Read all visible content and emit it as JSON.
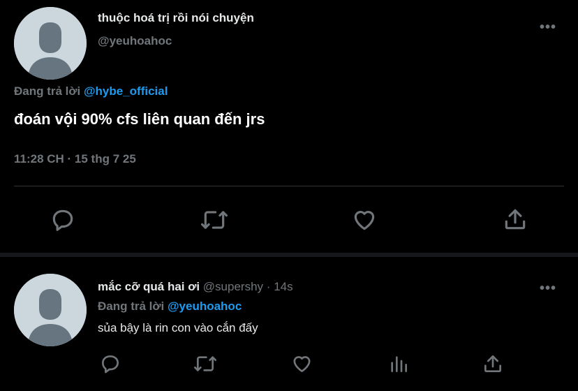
{
  "main_tweet": {
    "display_name": "thuộc hoá trị rồi nói chuyện",
    "handle": "@yeuhoahoc",
    "more_label": "•••",
    "replying_to_prefix": "Đang trả lời",
    "replying_to_handle": "@hybe_official",
    "text": "đoán vội 90% cfs liên quan đến jrs",
    "timestamp": "11:28 CH · 15 thg 7 25",
    "actions": [
      "reply-icon",
      "retweet-icon",
      "like-icon",
      "share-icon"
    ]
  },
  "reply_tweet": {
    "display_name": "mắc cỡ quá hai ơi",
    "handle": "@supershy",
    "separator": "·",
    "time_ago": "14s",
    "more_label": "•••",
    "replying_to_prefix": "Đang trả lời",
    "replying_to_handle": "@yeuhoahoc",
    "text": "sủa bậy là rin con vào cắn đấy",
    "actions": [
      "reply-icon",
      "retweet-icon",
      "like-icon",
      "analytics-icon",
      "share-icon"
    ]
  },
  "colors": {
    "background": "#000000",
    "text_primary": "#e7e9ea",
    "text_secondary": "#71767b",
    "accent": "#1d9bf0",
    "divider": "#2f3336"
  }
}
